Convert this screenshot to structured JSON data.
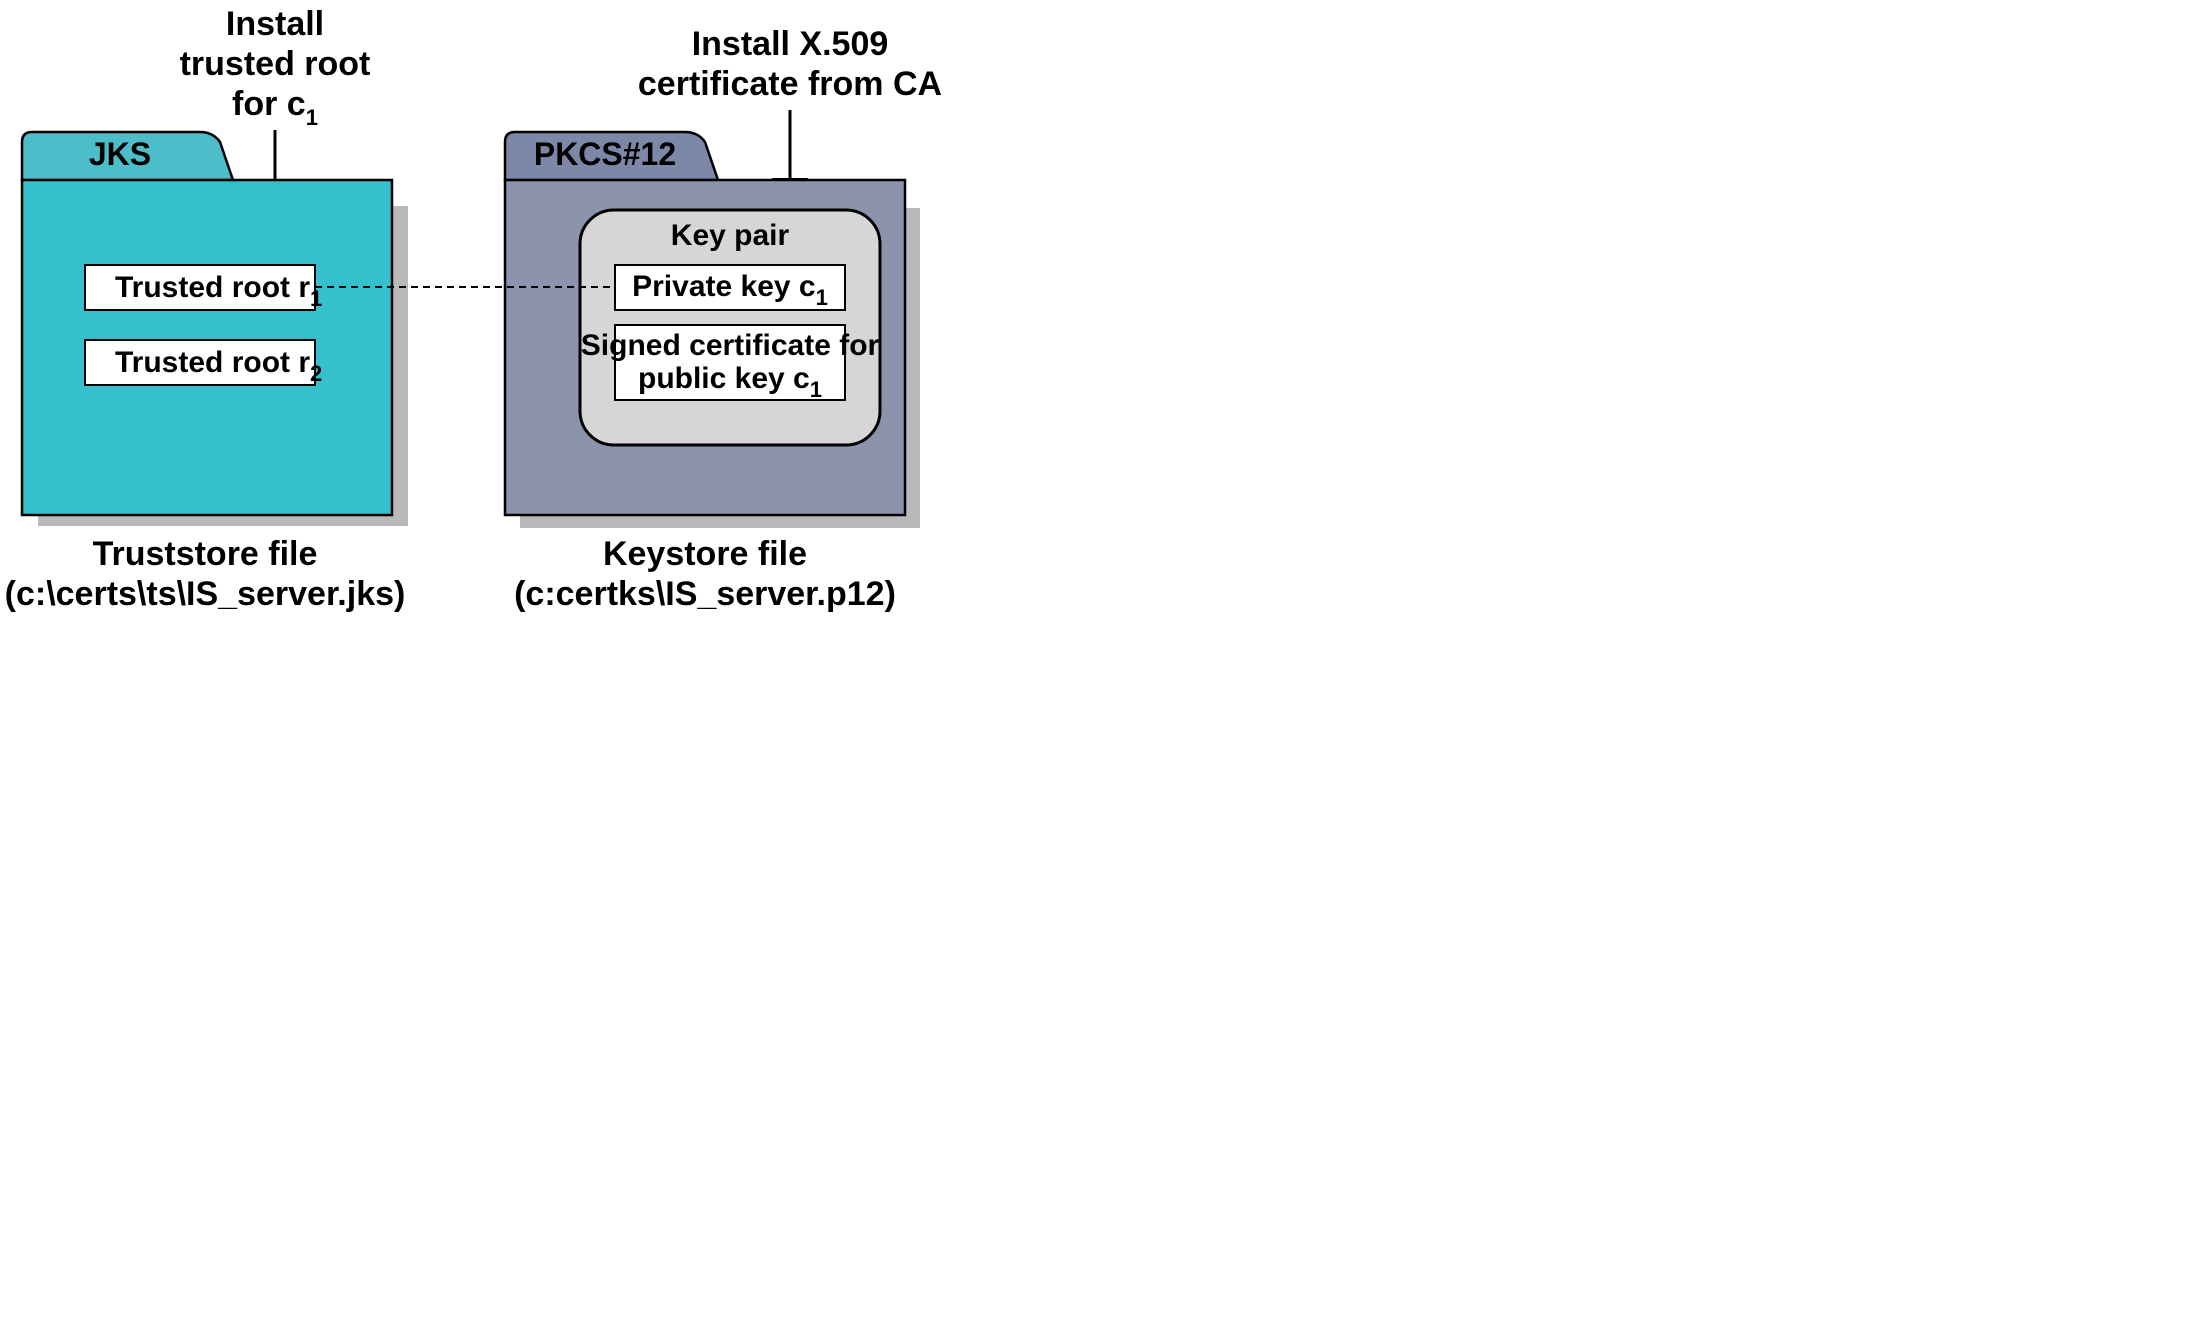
{
  "annotations": {
    "left": {
      "line1": "Install",
      "line2": "trusted root",
      "line3": "for c",
      "line3_sub": "1"
    },
    "right": {
      "line1": "Install X.509",
      "line2": "certificate from CA"
    }
  },
  "truststore": {
    "tab": "JKS",
    "rows": [
      {
        "label": "Trusted root r",
        "sub": "1"
      },
      {
        "label": "Trusted root r",
        "sub": "2"
      }
    ],
    "caption_line1": "Truststore file",
    "caption_line2": "(c:\\certs\\ts\\IS_server.jks)"
  },
  "keystore": {
    "tab": "PKCS#12",
    "keypair": {
      "title": "Key pair",
      "rows": [
        {
          "line1": "Private key c",
          "line1_sub": "1"
        },
        {
          "line1": "Signed certificate for",
          "line2": "public key c",
          "line2_sub": "1"
        }
      ]
    },
    "caption_line1": "Keystore file",
    "caption_line2": "(c:certks\\IS_server.p12)"
  },
  "colors": {
    "jks_tab": "#4cbdc9",
    "jks_body": "#36bfcc",
    "pkcs_tab": "#7d87a8",
    "pkcs_body": "#8c93ad",
    "keypair_bg": "#d6d6d6",
    "shadow": "#b9b9b9"
  }
}
